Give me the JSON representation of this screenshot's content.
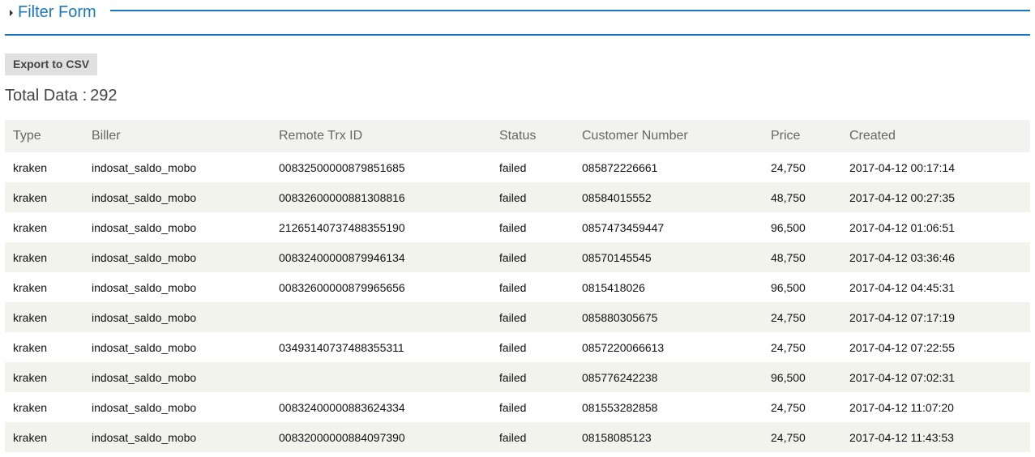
{
  "filter_form": {
    "title": "Filter Form"
  },
  "toolbar": {
    "export_label": "Export to CSV"
  },
  "summary": {
    "label": "Total Data :",
    "count": "292"
  },
  "table": {
    "headers": [
      "Type",
      "Biller",
      "Remote Trx ID",
      "Status",
      "Customer Number",
      "Price",
      "Created"
    ],
    "rows": [
      [
        "kraken",
        "indosat_saldo_mobo",
        "00832500000879851685",
        "failed",
        "085872226661",
        "24,750",
        "2017-04-12 00:17:14"
      ],
      [
        "kraken",
        "indosat_saldo_mobo",
        "00832600000881308816",
        "failed",
        "08584015552",
        "48,750",
        "2017-04-12 00:27:35"
      ],
      [
        "kraken",
        "indosat_saldo_mobo",
        "21265140737488355190",
        "failed",
        "0857473459447",
        "96,500",
        "2017-04-12 01:06:51"
      ],
      [
        "kraken",
        "indosat_saldo_mobo",
        "00832400000879946134",
        "failed",
        "08570145545",
        "48,750",
        "2017-04-12 03:36:46"
      ],
      [
        "kraken",
        "indosat_saldo_mobo",
        "00832600000879965656",
        "failed",
        "0815418026",
        "96,500",
        "2017-04-12 04:45:31"
      ],
      [
        "kraken",
        "indosat_saldo_mobo",
        "",
        "failed",
        "085880305675",
        "24,750",
        "2017-04-12 07:17:19"
      ],
      [
        "kraken",
        "indosat_saldo_mobo",
        "03493140737488355311",
        "failed",
        "0857220066613",
        "24,750",
        "2017-04-12 07:22:55"
      ],
      [
        "kraken",
        "indosat_saldo_mobo",
        "",
        "failed",
        "085776242238",
        "96,500",
        "2017-04-12 07:02:31"
      ],
      [
        "kraken",
        "indosat_saldo_mobo",
        "00832400000883624334",
        "failed",
        "081553282858",
        "24,750",
        "2017-04-12 11:07:20"
      ],
      [
        "kraken",
        "indosat_saldo_mobo",
        "00832000000884097390",
        "failed",
        "08158085123",
        "24,750",
        "2017-04-12 11:43:53"
      ]
    ]
  }
}
